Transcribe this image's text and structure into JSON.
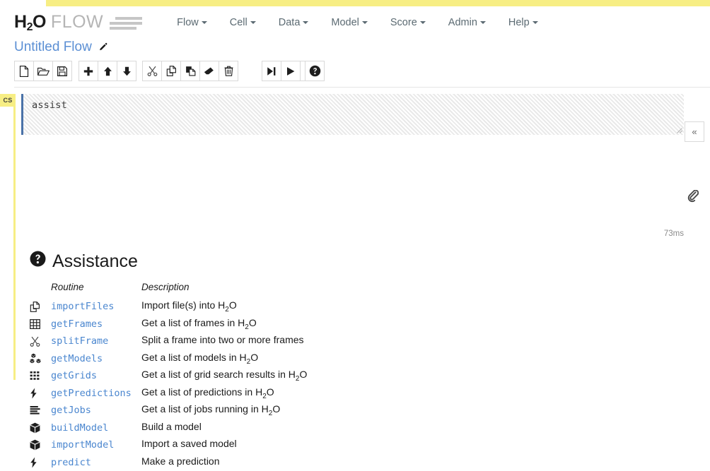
{
  "top_bar": {
    "color": "#f7ee84"
  },
  "brand": {
    "name_main": "H",
    "name_sub": "2",
    "name_main2": "O",
    "product": "FLOW",
    "flow_lines_icon": "flow-lines-icon"
  },
  "nav": {
    "items": [
      {
        "label": "Flow",
        "name": "nav-flow"
      },
      {
        "label": "Cell",
        "name": "nav-cell"
      },
      {
        "label": "Data",
        "name": "nav-data"
      },
      {
        "label": "Model",
        "name": "nav-model"
      },
      {
        "label": "Score",
        "name": "nav-score"
      },
      {
        "label": "Admin",
        "name": "nav-admin"
      },
      {
        "label": "Help",
        "name": "nav-help"
      }
    ]
  },
  "flow": {
    "title": "Untitled Flow",
    "title_color": "#5b8fd4",
    "edit_icon": "pencil-icon"
  },
  "toolbar": {
    "groups": [
      {
        "buttons": [
          {
            "icon": "new-file-icon",
            "name": "new-notebook-button"
          },
          {
            "icon": "open-folder-icon",
            "name": "open-notebook-button"
          },
          {
            "icon": "save-disk-icon",
            "name": "save-notebook-button"
          }
        ]
      },
      {
        "buttons": [
          {
            "icon": "plus-icon",
            "name": "insert-cell-button"
          },
          {
            "icon": "arrow-up-icon",
            "name": "move-cell-up-button"
          },
          {
            "icon": "arrow-down-icon",
            "name": "move-cell-down-button"
          }
        ]
      },
      {
        "buttons": [
          {
            "icon": "scissors-icon",
            "name": "cut-cell-button"
          },
          {
            "icon": "copy-icon",
            "name": "copy-cell-button"
          },
          {
            "icon": "paste-icon",
            "name": "paste-cell-button"
          },
          {
            "icon": "eraser-icon",
            "name": "clear-cell-button"
          },
          {
            "icon": "trash-icon",
            "name": "delete-cell-button"
          }
        ]
      },
      {
        "buttons": [
          {
            "icon": "step-forward-icon",
            "name": "run-and-select-below-button"
          },
          {
            "icon": "play-icon",
            "name": "run-cell-button"
          },
          {
            "icon": "fast-forward-icon",
            "name": "run-all-cells-button"
          }
        ]
      },
      {
        "buttons": [
          {
            "icon": "question-circle-icon",
            "name": "assist-button"
          }
        ]
      }
    ],
    "collapse_label": "«",
    "collapse_icon": "chevron-double-left-icon"
  },
  "cell": {
    "type_badge": "CS",
    "code": "assist",
    "timing": "73ms",
    "clip_icon": "paperclip-icon",
    "resize_icon": "resize-grip-icon",
    "marker_color": "#4a72a8"
  },
  "assistance": {
    "heading": "Assistance",
    "heading_icon": "question-circle-icon",
    "columns": {
      "routine": "Routine",
      "description": "Description"
    },
    "rows": [
      {
        "icon": "copy-files-icon",
        "routine": "importFiles",
        "desc_pre": "Import file(s) into H",
        "desc_sub": "2",
        "desc_post": "O"
      },
      {
        "icon": "table-icon",
        "routine": "getFrames",
        "desc_pre": "Get a list of frames in H",
        "desc_sub": "2",
        "desc_post": "O"
      },
      {
        "icon": "scissors-icon",
        "routine": "splitFrame",
        "desc_pre": "Split a frame into two or more frames",
        "desc_sub": "",
        "desc_post": ""
      },
      {
        "icon": "cubes-icon",
        "routine": "getModels",
        "desc_pre": "Get a list of models in H",
        "desc_sub": "2",
        "desc_post": "O"
      },
      {
        "icon": "grid-dots-icon",
        "routine": "getGrids",
        "desc_pre": "Get a list of grid search results in H",
        "desc_sub": "2",
        "desc_post": "O"
      },
      {
        "icon": "lightning-icon",
        "routine": "getPredictions",
        "desc_pre": "Get a list of predictions in H",
        "desc_sub": "2",
        "desc_post": "O"
      },
      {
        "icon": "tasks-icon",
        "routine": "getJobs",
        "desc_pre": "Get a list of jobs running in H",
        "desc_sub": "2",
        "desc_post": "O"
      },
      {
        "icon": "cube-icon",
        "routine": "buildModel",
        "desc_pre": "Build a model",
        "desc_sub": "",
        "desc_post": ""
      },
      {
        "icon": "cube-icon",
        "routine": "importModel",
        "desc_pre": "Import a saved model",
        "desc_sub": "",
        "desc_post": ""
      },
      {
        "icon": "lightning-icon",
        "routine": "predict",
        "desc_pre": "Make a prediction",
        "desc_sub": "",
        "desc_post": ""
      }
    ]
  }
}
